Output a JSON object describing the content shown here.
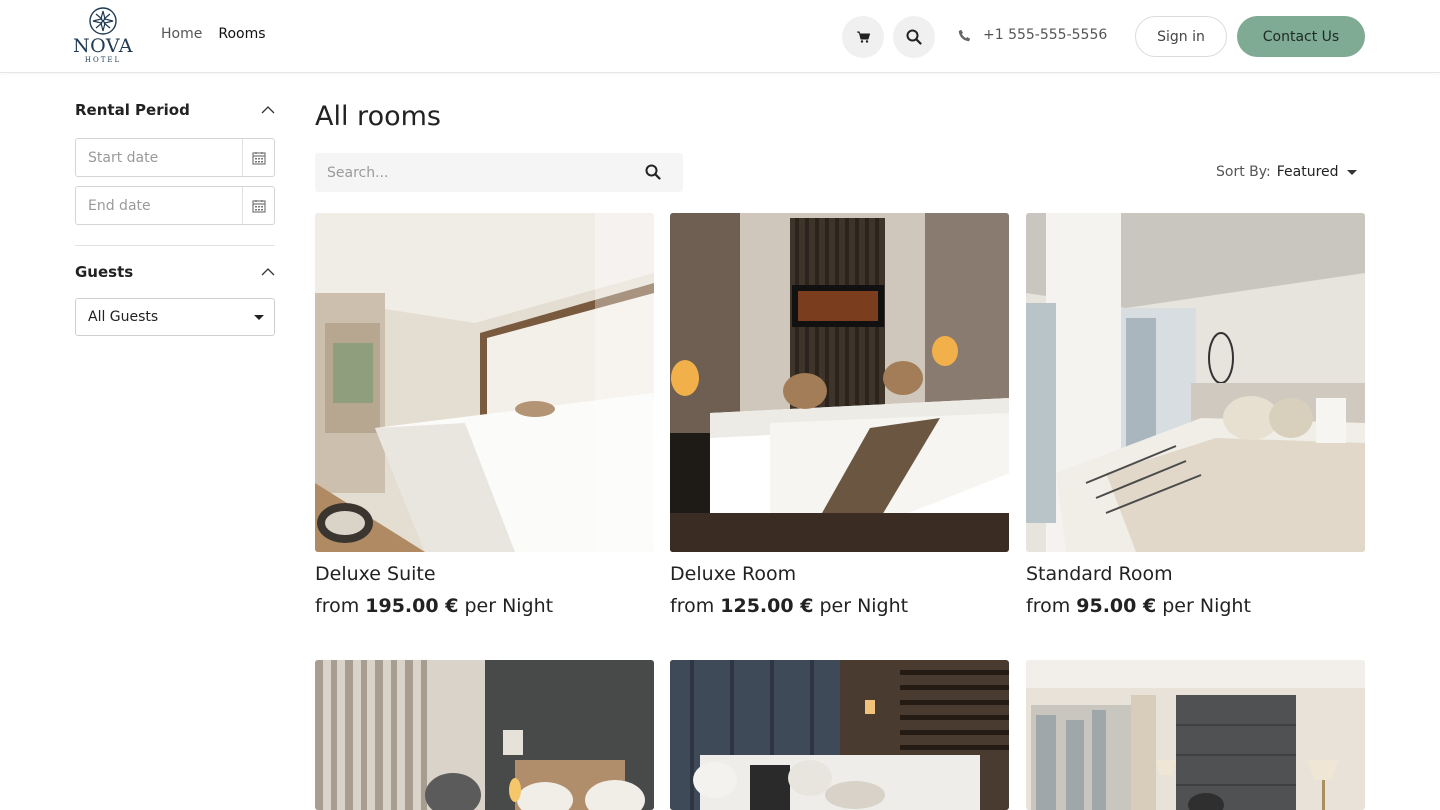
{
  "brand": {
    "name": "NOVA",
    "sub": "HOTEL"
  },
  "nav": {
    "home": "Home",
    "rooms": "Rooms"
  },
  "header": {
    "phone": "+1 555-555-5556",
    "signin": "Sign in",
    "contact": "Contact Us"
  },
  "sidebar": {
    "rental_title": "Rental Period",
    "start_placeholder": "Start date",
    "end_placeholder": "End date",
    "guests_title": "Guests",
    "guests_value": "All Guests"
  },
  "main": {
    "title": "All rooms",
    "search_placeholder": "Search...",
    "sort_label": "Sort By:",
    "sort_value": "Featured"
  },
  "rooms": [
    {
      "name": "Deluxe Suite",
      "from": "from",
      "price": "195.00 €",
      "unit": "per Night"
    },
    {
      "name": "Deluxe Room",
      "from": "from",
      "price": "125.00 €",
      "unit": "per Night"
    },
    {
      "name": "Standard Room",
      "from": "from",
      "price": "95.00 €",
      "unit": "per Night"
    },
    {
      "name": "",
      "from": "",
      "price": "",
      "unit": ""
    },
    {
      "name": "",
      "from": "",
      "price": "",
      "unit": ""
    },
    {
      "name": "",
      "from": "",
      "price": "",
      "unit": ""
    }
  ],
  "icons": {
    "cart": "cart-icon",
    "search": "search-icon",
    "phone": "phone-icon",
    "calendar": "calendar-icon",
    "chevron": "chevron-up-icon",
    "caret": "caret-down-icon"
  },
  "colors": {
    "accent": "#7faa93",
    "brand": "#1f3a52"
  }
}
